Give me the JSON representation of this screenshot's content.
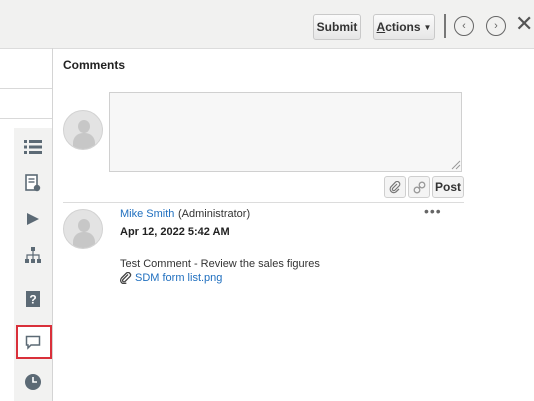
{
  "toolbar": {
    "submit_label": "Submit",
    "actions_label_underlined": "A",
    "actions_label_rest": "ctions",
    "prev_icon": "‹",
    "next_icon": "›",
    "close_icon": "✕"
  },
  "side_rail": {
    "icons": [
      "list-icon",
      "document-icon",
      "bell-icon",
      "hierarchy-icon",
      "help-icon",
      "comment-icon",
      "clock-icon"
    ],
    "selected": "comment-icon",
    "highlight_color": "#d9303a"
  },
  "comments_panel": {
    "title": "Comments",
    "input": {
      "value": "",
      "placeholder": ""
    },
    "post_label": "Post",
    "comments": [
      {
        "author": "Mike Smith",
        "role": "(Administrator)",
        "date": "Apr 12, 2022 5:42 AM",
        "text": "Test Comment - Review the sales figures",
        "attachment": "SDM form list.png",
        "menu": "•••"
      }
    ]
  },
  "colors": {
    "link": "#1f6fbf",
    "toolbar_bg": "#f1f1f0"
  }
}
